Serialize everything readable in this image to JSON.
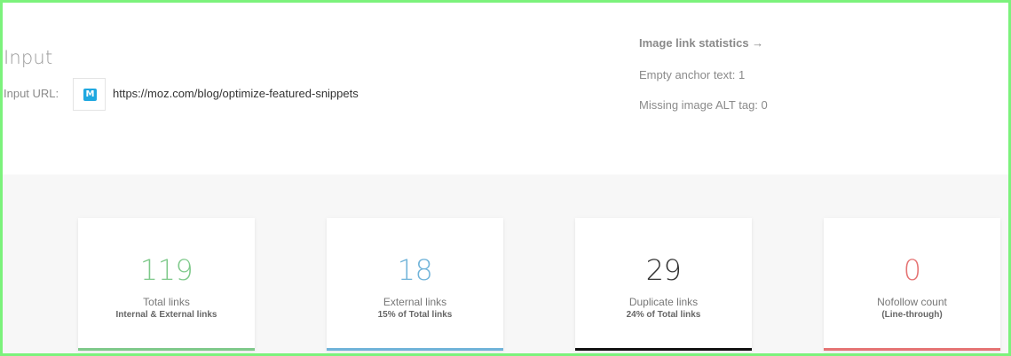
{
  "input": {
    "title": "Input",
    "url_label": "Input URL:",
    "url_value": "https://moz.com/blog/optimize-featured-snippets",
    "favicon_letter": "M",
    "favicon_icon": "moz-favicon-icon"
  },
  "image_stats": {
    "title": "Image link statistics →",
    "empty_anchor": "Empty anchor text: 1",
    "missing_alt": "Missing image ALT tag: 0"
  },
  "cards": [
    {
      "value": "119",
      "label": "Total links",
      "sub": "Internal & External links",
      "color": "#7ec98a"
    },
    {
      "value": "18",
      "label": "External links",
      "sub": "15% of Total links",
      "color": "#6fb3d9"
    },
    {
      "value": "29",
      "label": "Duplicate links",
      "sub": "24% of Total links",
      "color": "#333333"
    },
    {
      "value": "0",
      "label": "Nofollow count",
      "sub": "(Line-through)",
      "color": "#e57373"
    }
  ],
  "colors": {
    "frame": "#7cf27c",
    "gray_background": "#f7f7f7",
    "favicon_blue": "#1fa8e0"
  }
}
